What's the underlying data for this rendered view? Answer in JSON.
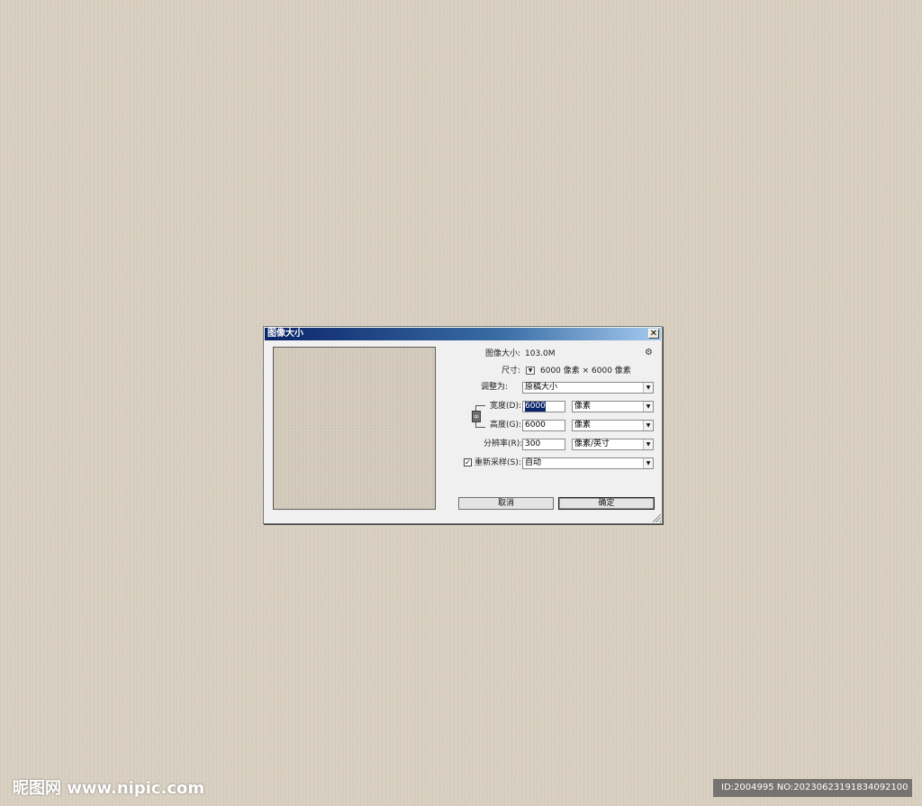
{
  "dialog": {
    "title": "图像大小",
    "close_symbol": "✕",
    "settings_icon": "gear-icon",
    "image_size_label": "图像大小:",
    "image_size_value": "103.0M",
    "dimensions_label": "尺寸:",
    "dimensions_value": "6000 像素 × 6000 像素",
    "fit_to_label": "调整为:",
    "fit_to_value": "原稿大小",
    "width_label": "宽度(D):",
    "width_value": "6000",
    "width_unit": "像素",
    "height_label": "高度(G):",
    "height_value": "6000",
    "height_unit": "像素",
    "resolution_label": "分辨率(R):",
    "resolution_value": "300",
    "resolution_unit": "像素/英寸",
    "resample_checked": true,
    "resample_label": "重新采样(S):",
    "resample_value": "自动",
    "cancel_label": "取消",
    "ok_label": "确定"
  },
  "watermark": {
    "left_text": "昵图网 www.nipic.com",
    "right_text": "ID:2004995 NO:20230623191834092100"
  }
}
